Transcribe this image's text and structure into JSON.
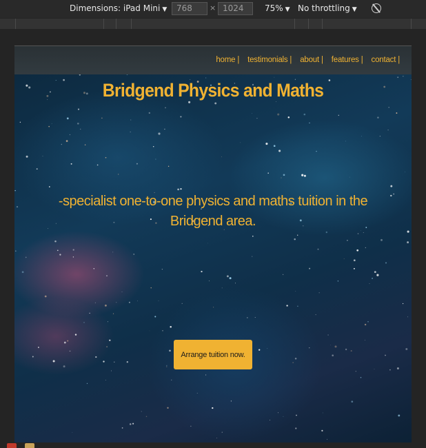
{
  "devtools": {
    "dimensions_label": "Dimensions: iPad Mini",
    "width_value": "768",
    "height_value": "1024",
    "times_sign": "×",
    "zoom": "75%",
    "throttling": "No throttling",
    "caret": "▼",
    "icons": [
      "rotate-icon"
    ]
  },
  "site": {
    "nav": [
      "home |",
      "testimonials |",
      "about |",
      "features |",
      "contact |"
    ],
    "title": "Bridgend Physics and Maths",
    "tagline": "-specialist one-to-one physics and maths tuition in the Bridgend area.",
    "cta_label": "Arrange tuition now."
  },
  "colors": {
    "accent": "#f0b232",
    "navbar": "#2f373b",
    "devtools_bg": "#292929"
  }
}
